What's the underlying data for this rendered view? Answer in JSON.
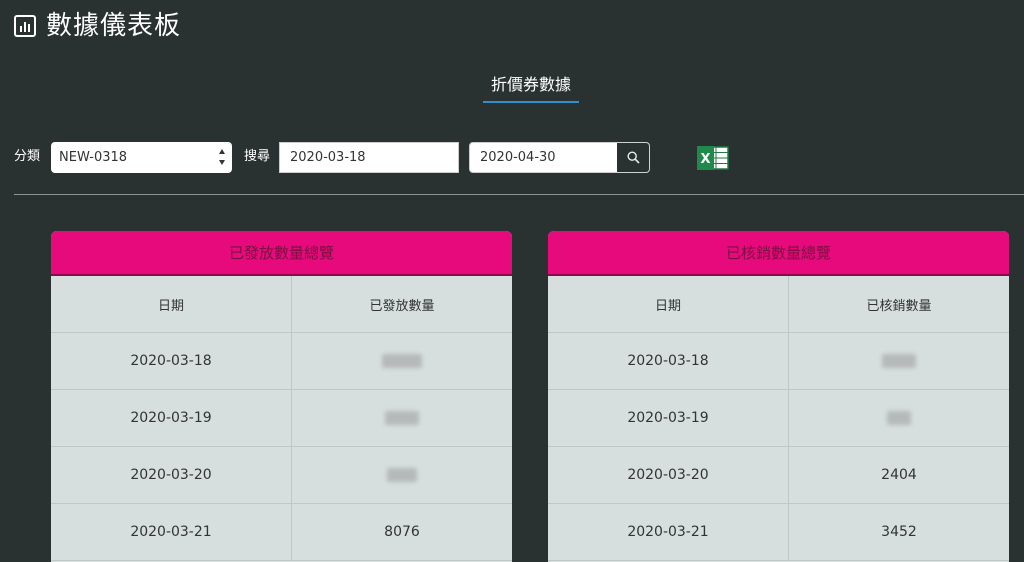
{
  "header": {
    "title": "數據儀表板",
    "icon": "bar-chart-icon"
  },
  "tabs": [
    {
      "label": "折價券數據",
      "active": true
    }
  ],
  "filters": {
    "category_label": "分類",
    "category_value": "NEW-0318",
    "search_label": "搜尋",
    "start_date": "2020-03-18",
    "end_date": "2020-04-30",
    "search_icon": "search-icon",
    "export_icon": "excel-export-icon"
  },
  "panels": {
    "issued": {
      "title": "已發放數量總覽",
      "columns": [
        "日期",
        "已發放數量"
      ],
      "rows": [
        {
          "date": "2020-03-18",
          "value": ""
        },
        {
          "date": "2020-03-19",
          "value": ""
        },
        {
          "date": "2020-03-20",
          "value": ""
        },
        {
          "date": "2020-03-21",
          "value": "8076"
        }
      ]
    },
    "redeemed": {
      "title": "已核銷數量總覽",
      "columns": [
        "日期",
        "已核銷數量"
      ],
      "rows": [
        {
          "date": "2020-03-18",
          "value": ""
        },
        {
          "date": "2020-03-19",
          "value": ""
        },
        {
          "date": "2020-03-20",
          "value": "2404"
        },
        {
          "date": "2020-03-21",
          "value": "3452"
        }
      ]
    }
  },
  "colors": {
    "background": "#2a3231",
    "panel_header": "#e60a7c",
    "panel_body": "#d7dfde",
    "tab_underline": "#2f8fd0"
  }
}
